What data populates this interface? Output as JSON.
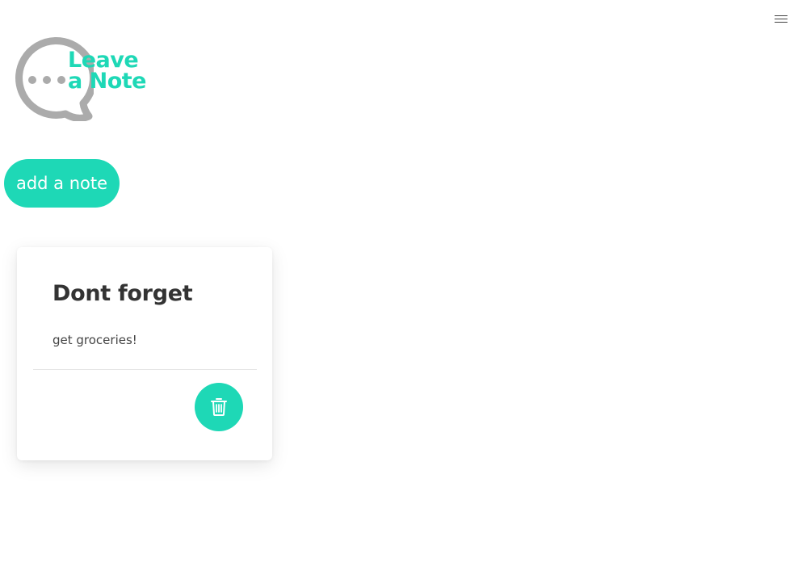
{
  "header": {
    "menu_icon": "hamburger-menu-icon"
  },
  "logo": {
    "line1": "Leave",
    "line2": "a Note",
    "icon": "speech-bubble-dots-icon",
    "accent_color": "#1ed8b6",
    "bubble_color": "#ababab"
  },
  "actions": {
    "add_label": "add a note"
  },
  "notes": [
    {
      "title": "Dont forget",
      "content": "get groceries!",
      "delete_icon": "trash-icon"
    }
  ],
  "colors": {
    "accent": "#1ed8b6",
    "title_text": "#333333",
    "body_text": "#444444",
    "background": "#ffffff"
  }
}
